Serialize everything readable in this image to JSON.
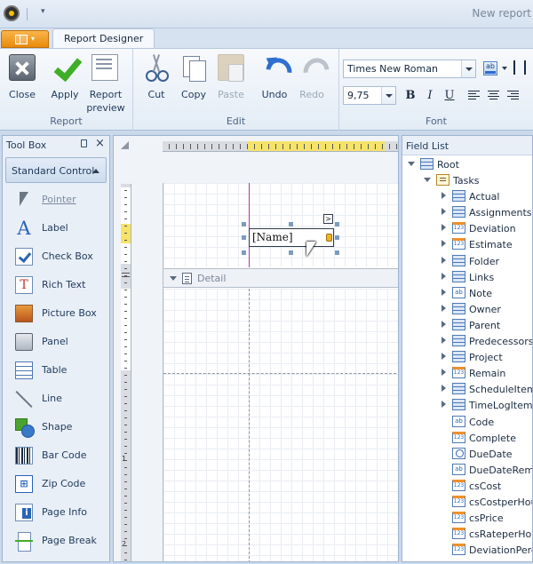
{
  "window": {
    "title": "New report"
  },
  "tabs": {
    "active": "Report Designer"
  },
  "ribbon": {
    "groups": {
      "report": "Report",
      "edit": "Edit",
      "font": "Font"
    },
    "buttons": {
      "close": "Close",
      "apply": "Apply",
      "report_preview": "Report preview",
      "cut": "Cut",
      "copy": "Copy",
      "paste": "Paste",
      "undo": "Undo",
      "redo": "Redo"
    },
    "font": {
      "name": "Times New Roman",
      "size": "9,75",
      "bold": "B",
      "italic": "I",
      "underline": "U",
      "color_glyph": "ab"
    }
  },
  "toolbox": {
    "title": "Tool Box",
    "category": "Standard Control",
    "items": [
      {
        "label": "Pointer",
        "icon": "pointer-icon"
      },
      {
        "label": "Label",
        "icon": "label-icon"
      },
      {
        "label": "Check Box",
        "icon": "checkbox-icon"
      },
      {
        "label": "Rich Text",
        "icon": "rich-text-icon"
      },
      {
        "label": "Picture Box",
        "icon": "picture-box-icon"
      },
      {
        "label": "Panel",
        "icon": "panel-icon"
      },
      {
        "label": "Table",
        "icon": "table-icon"
      },
      {
        "label": "Line",
        "icon": "line-icon"
      },
      {
        "label": "Shape",
        "icon": "shape-icon"
      },
      {
        "label": "Bar Code",
        "icon": "barcode-icon"
      },
      {
        "label": "Zip Code",
        "icon": "zip-code-icon"
      },
      {
        "label": "Page Info",
        "icon": "page-info-icon"
      },
      {
        "label": "Page Break",
        "icon": "page-break-icon"
      }
    ]
  },
  "designer": {
    "detail_band": "Detail",
    "name_field": "[Name]",
    "smart_tag": ">",
    "ruler_labels": [
      "1",
      "2"
    ]
  },
  "field_list": {
    "title": "Field List",
    "root": "Root",
    "tasks": "Tasks",
    "nodes": [
      {
        "label": "Actual",
        "type": "table",
        "expandable": true
      },
      {
        "label": "Assignments",
        "type": "table",
        "expandable": true
      },
      {
        "label": "Deviation",
        "type": "number",
        "expandable": true
      },
      {
        "label": "Estimate",
        "type": "number",
        "expandable": true
      },
      {
        "label": "Folder",
        "type": "table",
        "expandable": true
      },
      {
        "label": "Links",
        "type": "table",
        "expandable": true
      },
      {
        "label": "Note",
        "type": "text",
        "expandable": true
      },
      {
        "label": "Owner",
        "type": "table",
        "expandable": true
      },
      {
        "label": "Parent",
        "type": "table",
        "expandable": true
      },
      {
        "label": "Predecessors",
        "type": "table",
        "expandable": true
      },
      {
        "label": "Project",
        "type": "table",
        "expandable": true
      },
      {
        "label": "Remain",
        "type": "number",
        "expandable": true
      },
      {
        "label": "ScheduleItems",
        "type": "table",
        "expandable": true
      },
      {
        "label": "TimeLogItems",
        "type": "table",
        "expandable": true
      },
      {
        "label": "Code",
        "type": "text",
        "expandable": false
      },
      {
        "label": "Complete",
        "type": "number",
        "expandable": false
      },
      {
        "label": "DueDate",
        "type": "date",
        "expandable": false
      },
      {
        "label": "DueDateRemin",
        "type": "text",
        "expandable": false
      },
      {
        "label": "csCost",
        "type": "number",
        "expandable": false
      },
      {
        "label": "csCostperHour",
        "type": "number",
        "expandable": false
      },
      {
        "label": "csPrice",
        "type": "number",
        "expandable": false
      },
      {
        "label": "csRateperHour",
        "type": "number",
        "expandable": false
      },
      {
        "label": "DeviationPerce",
        "type": "number",
        "expandable": false
      }
    ]
  }
}
